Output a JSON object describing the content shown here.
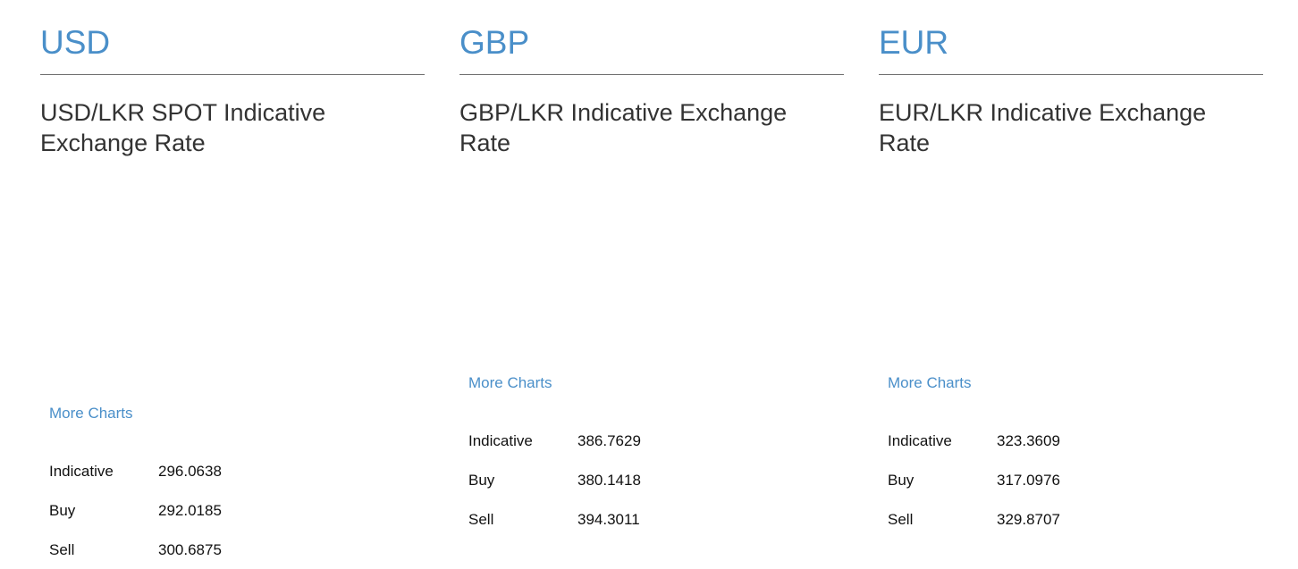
{
  "colors": {
    "accent": "#4a8fc9",
    "text": "#333333",
    "rule": "#6f6f6f"
  },
  "panels": [
    {
      "currency": "USD",
      "subtitle": "USD/LKR SPOT Indicative Exchange Rate",
      "more_charts": "More Charts",
      "rows": [
        {
          "label": "Indicative",
          "value": "296.0638"
        },
        {
          "label": "Buy",
          "value": "292.0185"
        },
        {
          "label": "Sell",
          "value": "300.6875"
        }
      ]
    },
    {
      "currency": "GBP",
      "subtitle": "GBP/LKR Indicative Exchange Rate",
      "more_charts": "More Charts",
      "rows": [
        {
          "label": "Indicative",
          "value": "386.7629"
        },
        {
          "label": "Buy",
          "value": "380.1418"
        },
        {
          "label": "Sell",
          "value": "394.3011"
        }
      ]
    },
    {
      "currency": "EUR",
      "subtitle": "EUR/LKR Indicative Exchange Rate",
      "more_charts": "More Charts",
      "rows": [
        {
          "label": "Indicative",
          "value": "323.3609"
        },
        {
          "label": "Buy",
          "value": "317.0976"
        },
        {
          "label": "Sell",
          "value": "329.8707"
        }
      ]
    }
  ]
}
